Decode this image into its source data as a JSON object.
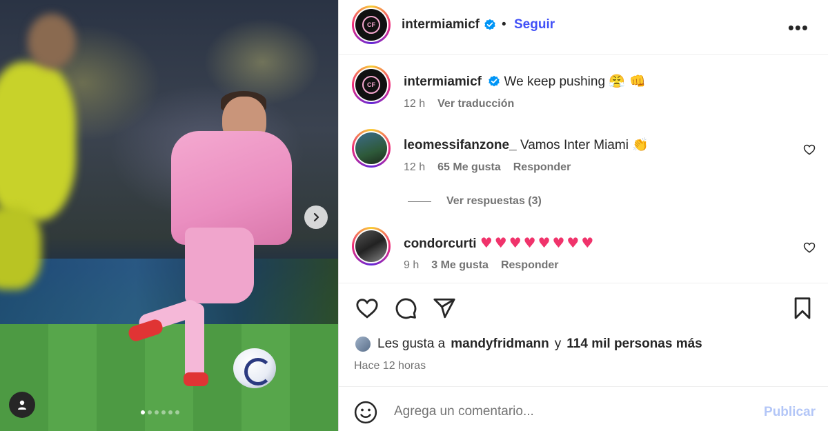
{
  "post": {
    "author": "intermiamicf",
    "follow_label": "Seguir",
    "dot_separator": "•",
    "more_label": "•••",
    "crest_text": "CF",
    "carousel": {
      "slides": 6,
      "active": 1
    }
  },
  "caption": {
    "username": "intermiamicf",
    "text": "We keep pushing",
    "emojis": "😤 👊",
    "time": "12 h",
    "translate_label": "Ver traducción"
  },
  "comments": [
    {
      "username": "leomessifanzone_",
      "text": "Vamos Inter Miami",
      "emojis": "👏",
      "time": "12 h",
      "likes": "65 Me gusta",
      "reply_label": "Responder"
    },
    {
      "username": "condorcurti",
      "text": "",
      "emojis": "♥♥♥♥♥♥♥♥",
      "time": "9 h",
      "likes": "3 Me gusta",
      "reply_label": "Responder"
    }
  ],
  "view_replies": "Ver respuestas (3)",
  "likes_summary": {
    "prefix": "Les gusta a",
    "user": "mandyfridmann",
    "joiner": "y",
    "others": "114 mil personas más"
  },
  "posted_time": "Hace 12 horas",
  "composer": {
    "placeholder": "Agrega un comentario...",
    "publish_label": "Publicar"
  },
  "colors": {
    "link_blue": "#4150f7",
    "publish_disabled": "#b3c6f7",
    "verified_blue": "#0095f6",
    "heart_red": "#f0336b"
  }
}
